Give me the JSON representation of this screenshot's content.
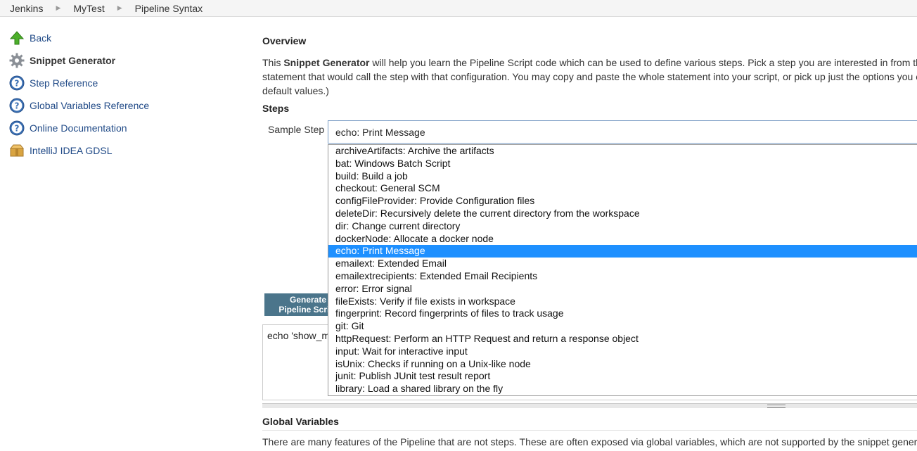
{
  "breadcrumb": [
    "Jenkins",
    "MyTest",
    "Pipeline Syntax"
  ],
  "sidebar": {
    "items": [
      {
        "label": "Back",
        "icon": "up-arrow-icon"
      },
      {
        "label": "Snippet Generator",
        "icon": "gear-icon",
        "active": true
      },
      {
        "label": "Step Reference",
        "icon": "help-icon"
      },
      {
        "label": "Global Variables Reference",
        "icon": "help-icon"
      },
      {
        "label": "Online Documentation",
        "icon": "help-icon"
      },
      {
        "label": "IntelliJ IDEA GDSL",
        "icon": "package-icon"
      }
    ]
  },
  "overview": {
    "title": "Overview",
    "text_pre": "This ",
    "text_bold": "Snippet Generator",
    "text_post": " will help you learn the Pipeline Script code which can be used to define various steps. Pick a step you are interested in from th statement that would call the step with that configuration. You may copy and paste the whole statement into your script, or pick up just the options you c them at default values.)"
  },
  "steps": {
    "title": "Steps",
    "sample_label": "Sample Step",
    "selected": "echo: Print Message",
    "options": [
      "archiveArtifacts: Archive the artifacts",
      "bat: Windows Batch Script",
      "build: Build a job",
      "checkout: General SCM",
      "configFileProvider: Provide Configuration files",
      "deleteDir: Recursively delete the current directory from the workspace",
      "dir: Change current directory",
      "dockerNode: Allocate a docker node",
      "echo: Print Message",
      "emailext: Extended Email",
      "emailextrecipients: Extended Email Recipients",
      "error: Error signal",
      "fileExists: Verify if file exists in workspace",
      "fingerprint: Record fingerprints of files to track usage",
      "git: Git",
      "httpRequest: Perform an HTTP Request and return a response object",
      "input: Wait for interactive input",
      "isUnix: Checks if running on a Unix-like node",
      "junit: Publish JUnit test result report",
      "library: Load a shared library on the fly"
    ],
    "selected_index": 8,
    "generate_label": "Generate Pipeline Script",
    "script": "echo 'show_m"
  },
  "global_vars": {
    "title": "Global Variables",
    "text": "There are many features of the Pipeline that are not steps. These are often exposed via global variables, which are not supported by the snippet gener"
  },
  "colors": {
    "link": "#204a87",
    "selected_option": "#1e90ff",
    "button": "#4b758b"
  }
}
